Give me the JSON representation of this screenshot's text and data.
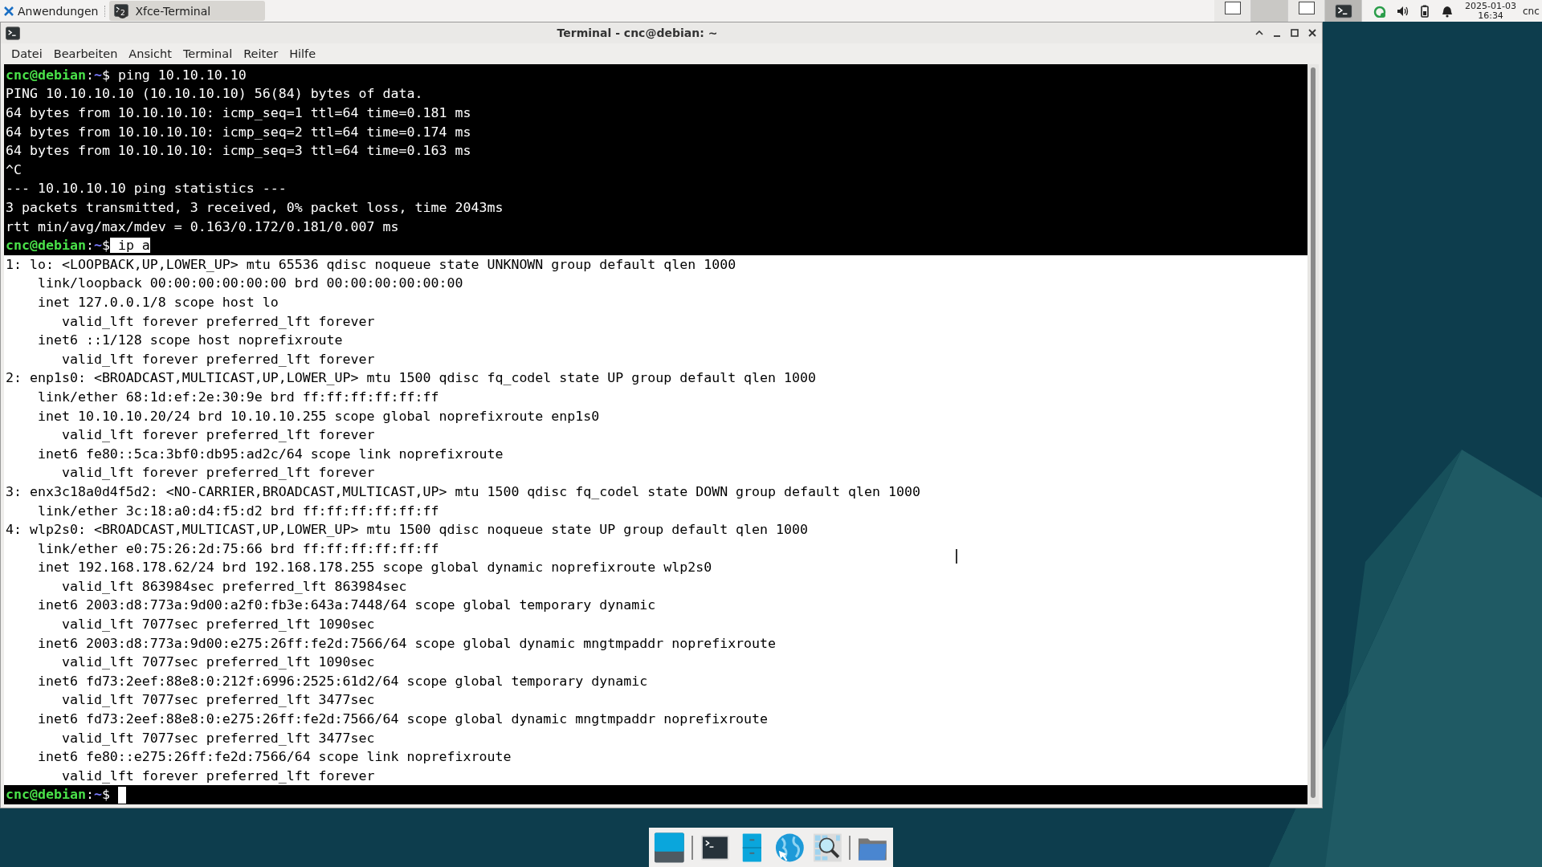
{
  "top_panel": {
    "app_menu": "Anwendungen",
    "tasks": [
      {
        "label": "Xfce-Terminal",
        "count": "2",
        "selected": true
      }
    ],
    "workspaces": [
      {
        "selected": false,
        "has_window": true
      },
      {
        "selected": false,
        "has_window": false
      },
      {
        "selected": false,
        "has_window": true
      },
      {
        "selected": true,
        "has_window": true
      }
    ],
    "clock": {
      "date": "2025-01-03",
      "time": "16:34"
    },
    "user": "cnc"
  },
  "window": {
    "title": "Terminal - cnc@debian: ~",
    "menu": [
      "Datei",
      "Bearbeiten",
      "Ansicht",
      "Terminal",
      "Reiter",
      "Hilfe"
    ]
  },
  "terminal": {
    "lines": [
      {
        "kind": "prompt",
        "user": "cnc@debian",
        "sep": ":",
        "dir": "~",
        "sign": "$",
        "command": "ping 10.10.10.10",
        "inverted": false
      },
      {
        "kind": "output",
        "text": "PING 10.10.10.10 (10.10.10.10) 56(84) bytes of data.",
        "inverted": false
      },
      {
        "kind": "output",
        "text": "64 bytes from 10.10.10.10: icmp_seq=1 ttl=64 time=0.181 ms",
        "inverted": false
      },
      {
        "kind": "output",
        "text": "64 bytes from 10.10.10.10: icmp_seq=2 ttl=64 time=0.174 ms",
        "inverted": false
      },
      {
        "kind": "output",
        "text": "64 bytes from 10.10.10.10: icmp_seq=3 ttl=64 time=0.163 ms",
        "inverted": false
      },
      {
        "kind": "output",
        "text": "^C",
        "inverted": false
      },
      {
        "kind": "output",
        "text": "--- 10.10.10.10 ping statistics ---",
        "inverted": false
      },
      {
        "kind": "output",
        "text": "3 packets transmitted, 3 received, 0% packet loss, time 2043ms",
        "inverted": false
      },
      {
        "kind": "output",
        "text": "rtt min/avg/max/mdev = 0.163/0.172/0.181/0.007 ms",
        "inverted": false
      },
      {
        "kind": "prompt",
        "user": "cnc@debian",
        "sep": ":",
        "dir": "~",
        "sign": "$",
        "command": "ip a",
        "inverted": true
      },
      {
        "kind": "output",
        "text": "1: lo: <LOOPBACK,UP,LOWER_UP> mtu 65536 qdisc noqueue state UNKNOWN group default qlen 1000",
        "inverted": true
      },
      {
        "kind": "output",
        "text": "    link/loopback 00:00:00:00:00:00 brd 00:00:00:00:00:00",
        "inverted": true
      },
      {
        "kind": "output",
        "text": "    inet 127.0.0.1/8 scope host lo",
        "inverted": true
      },
      {
        "kind": "output",
        "text": "       valid_lft forever preferred_lft forever",
        "inverted": true
      },
      {
        "kind": "output",
        "text": "    inet6 ::1/128 scope host noprefixroute",
        "inverted": true
      },
      {
        "kind": "output",
        "text": "       valid_lft forever preferred_lft forever",
        "inverted": true
      },
      {
        "kind": "output",
        "text": "2: enp1s0: <BROADCAST,MULTICAST,UP,LOWER_UP> mtu 1500 qdisc fq_codel state UP group default qlen 1000",
        "inverted": true
      },
      {
        "kind": "output",
        "text": "    link/ether 68:1d:ef:2e:30:9e brd ff:ff:ff:ff:ff:ff",
        "inverted": true
      },
      {
        "kind": "output",
        "text": "    inet 10.10.10.20/24 brd 10.10.10.255 scope global noprefixroute enp1s0",
        "inverted": true
      },
      {
        "kind": "output",
        "text": "       valid_lft forever preferred_lft forever",
        "inverted": true
      },
      {
        "kind": "output",
        "text": "    inet6 fe80::5ca:3bf0:db95:ad2c/64 scope link noprefixroute",
        "inverted": true
      },
      {
        "kind": "output",
        "text": "       valid_lft forever preferred_lft forever",
        "inverted": true
      },
      {
        "kind": "output",
        "text": "3: enx3c18a0d4f5d2: <NO-CARRIER,BROADCAST,MULTICAST,UP> mtu 1500 qdisc fq_codel state DOWN group default qlen 1000",
        "inverted": true
      },
      {
        "kind": "output",
        "text": "    link/ether 3c:18:a0:d4:f5:d2 brd ff:ff:ff:ff:ff:ff",
        "inverted": true
      },
      {
        "kind": "output",
        "text": "4: wlp2s0: <BROADCAST,MULTICAST,UP,LOWER_UP> mtu 1500 qdisc noqueue state UP group default qlen 1000",
        "inverted": true
      },
      {
        "kind": "output",
        "text": "    link/ether e0:75:26:2d:75:66 brd ff:ff:ff:ff:ff:ff",
        "inverted": true
      },
      {
        "kind": "output",
        "text": "    inet 192.168.178.62/24 brd 192.168.178.255 scope global dynamic noprefixroute wlp2s0",
        "inverted": true
      },
      {
        "kind": "output",
        "text": "       valid_lft 863984sec preferred_lft 863984sec",
        "inverted": true
      },
      {
        "kind": "output",
        "text": "    inet6 2003:d8:773a:9d00:a2f0:fb3e:643a:7448/64 scope global temporary dynamic",
        "inverted": true
      },
      {
        "kind": "output",
        "text": "       valid_lft 7077sec preferred_lft 1090sec",
        "inverted": true
      },
      {
        "kind": "output",
        "text": "    inet6 2003:d8:773a:9d00:e275:26ff:fe2d:7566/64 scope global dynamic mngtmpaddr noprefixroute",
        "inverted": true
      },
      {
        "kind": "output",
        "text": "       valid_lft 7077sec preferred_lft 1090sec",
        "inverted": true
      },
      {
        "kind": "output",
        "text": "    inet6 fd73:2eef:88e8:0:212f:6996:2525:61d2/64 scope global temporary dynamic",
        "inverted": true
      },
      {
        "kind": "output",
        "text": "       valid_lft 7077sec preferred_lft 3477sec",
        "inverted": true
      },
      {
        "kind": "output",
        "text": "    inet6 fd73:2eef:88e8:0:e275:26ff:fe2d:7566/64 scope global dynamic mngtmpaddr noprefixroute",
        "inverted": true
      },
      {
        "kind": "output",
        "text": "       valid_lft 7077sec preferred_lft 3477sec",
        "inverted": true
      },
      {
        "kind": "output",
        "text": "    inet6 fe80::e275:26ff:fe2d:7566/64 scope link noprefixroute",
        "inverted": true
      },
      {
        "kind": "output",
        "text": "       valid_lft forever preferred_lft forever",
        "inverted": true
      },
      {
        "kind": "prompt",
        "user": "cnc@debian",
        "sep": ":",
        "dir": "~",
        "sign": "$",
        "inverted": false,
        "cursor": true
      }
    ]
  },
  "dock": [
    {
      "kind": "desktop"
    },
    {
      "kind": "separator"
    },
    {
      "kind": "terminal"
    },
    {
      "kind": "cabinet"
    },
    {
      "kind": "globe"
    },
    {
      "kind": "search"
    },
    {
      "kind": "separator"
    },
    {
      "kind": "folder"
    }
  ]
}
